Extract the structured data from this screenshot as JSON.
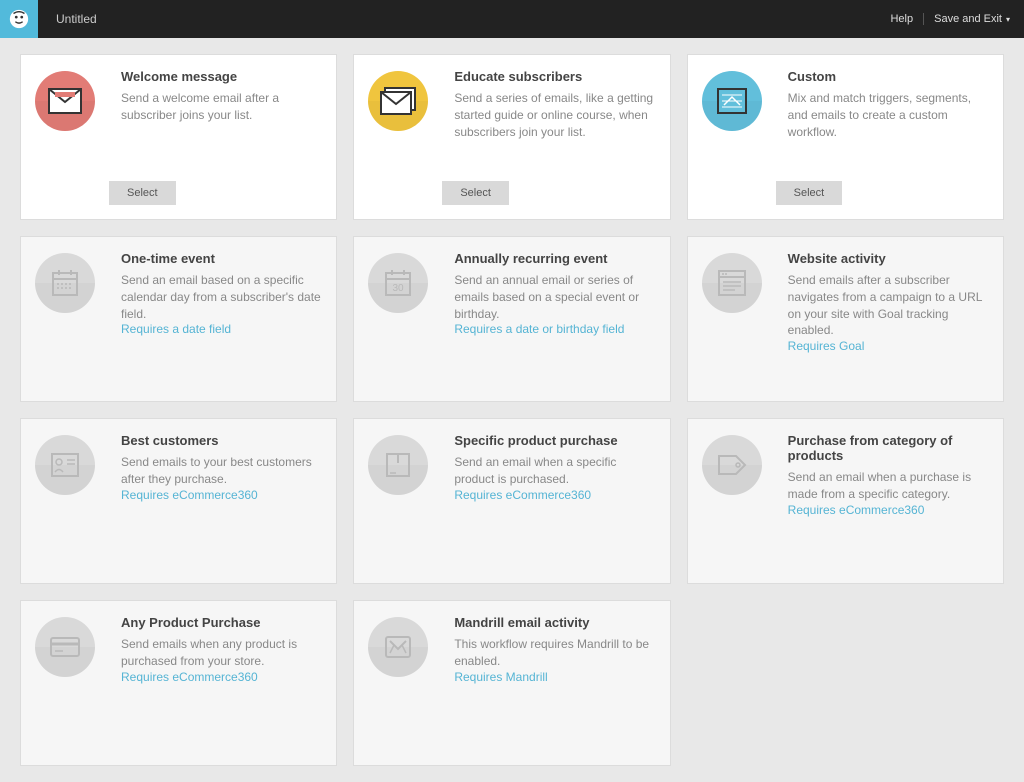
{
  "header": {
    "title": "Untitled",
    "help": "Help",
    "save_exit": "Save and Exit"
  },
  "select_label": "Select",
  "cards": [
    {
      "title": "Welcome message",
      "desc": "Send a welcome email after a subscriber joins your list.",
      "link": ""
    },
    {
      "title": "Educate subscribers",
      "desc": "Send a series of emails, like a getting started guide or online course, when subscribers join your list.",
      "link": ""
    },
    {
      "title": "Custom",
      "desc": "Mix and match triggers, segments, and emails to create a custom workflow.",
      "link": ""
    },
    {
      "title": "One-time event",
      "desc": "Send an email based on a specific calendar day from a subscriber's date field.",
      "link": "Requires a date field"
    },
    {
      "title": "Annually recurring event",
      "desc": "Send an annual email or series of emails based on a special event or birthday.",
      "link": "Requires a date or birthday field"
    },
    {
      "title": "Website activity",
      "desc": "Send emails after a subscriber navigates from a campaign to a URL on your site with Goal tracking enabled.",
      "link": "Requires Goal"
    },
    {
      "title": "Best customers",
      "desc": "Send emails to your best customers after they purchase.",
      "link": "Requires eCommerce360"
    },
    {
      "title": "Specific product purchase",
      "desc": "Send an email when a specific product is purchased.",
      "link": "Requires eCommerce360"
    },
    {
      "title": "Purchase from category of products",
      "desc": "Send an email when a purchase is made from a specific category.",
      "link": "Requires eCommerce360"
    },
    {
      "title": "Any Product Purchase",
      "desc": "Send emails when any product is purchased from your store.",
      "link": "Requires eCommerce360"
    },
    {
      "title": "Mandrill email activity",
      "desc": "This workflow requires Mandrill to be enabled.",
      "link": "Requires Mandrill"
    }
  ]
}
